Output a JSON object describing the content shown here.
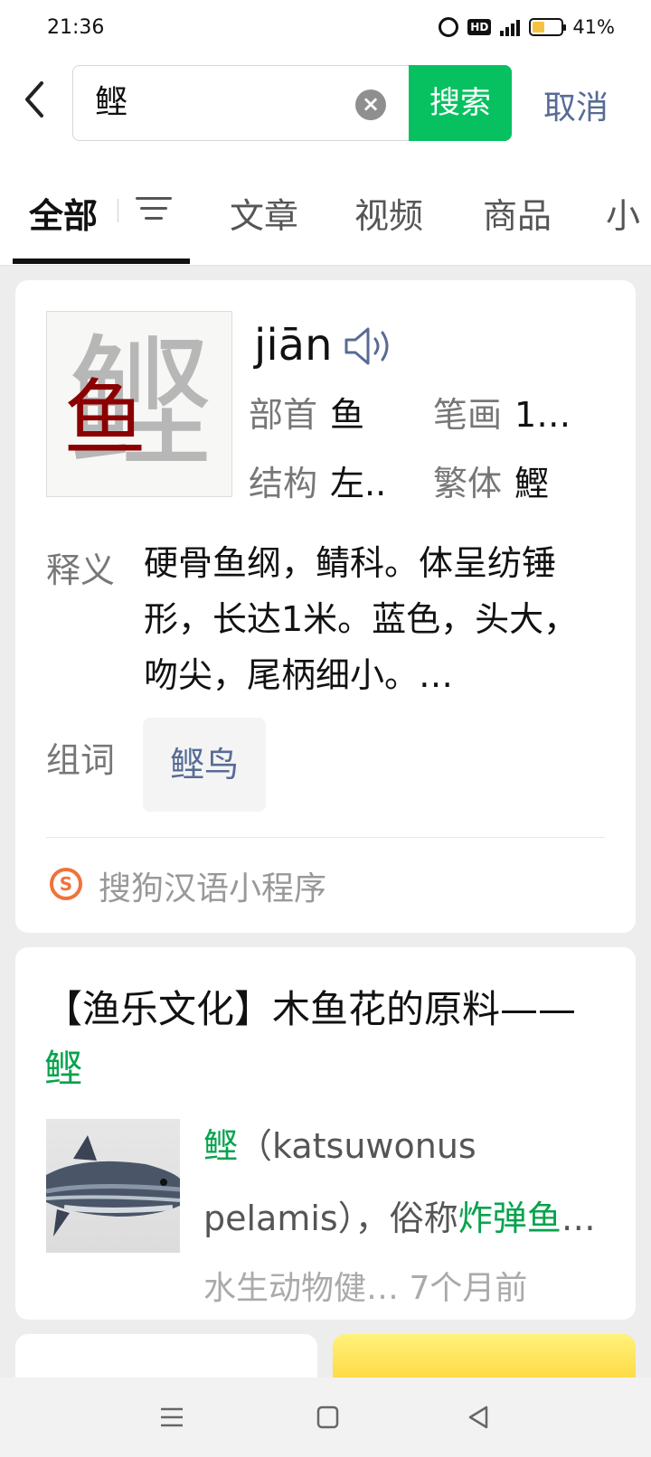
{
  "status_bar": {
    "time": "21:36",
    "network": "4G",
    "battery": "41%",
    "battery_level": 0.41,
    "hd_label": "HD"
  },
  "search": {
    "query": "鲣",
    "search_label": "搜索",
    "cancel_label": "取消"
  },
  "tabs": [
    {
      "label": "全部",
      "active": true
    },
    {
      "label": "文章",
      "active": false
    },
    {
      "label": "视频",
      "active": false
    },
    {
      "label": "商品",
      "active": false
    },
    {
      "label": "小",
      "active": false
    }
  ],
  "dictionary": {
    "character": "鲣",
    "radical_part": "鱼",
    "pinyin": "jiān",
    "radical_label": "部首",
    "radical_value": "鱼",
    "strokes_label": "笔画",
    "strokes_value": "1…",
    "structure_label": "结构",
    "structure_value": "左..",
    "traditional_label": "繁体",
    "traditional_value": "鰹",
    "definition_label": "释义",
    "definition": "硬骨鱼纲，鲭科。体呈纺锤形，长达1米。蓝色，头大，吻尖，尾柄细小。…",
    "words_label": "组词",
    "words": [
      "鲣鸟"
    ],
    "source": "搜狗汉语小程序",
    "source_icon": "sogou-icon"
  },
  "article": {
    "title_main": "【渔乐文化】木鱼花的原料——",
    "title_highlight": "鲣",
    "snippet_highlight_1": "鲣",
    "snippet_part_1": "（katsuwonus pelamis），俗称",
    "snippet_highlight_2": "炸弹鱼",
    "snippet_ellipsis": "…",
    "meta": "水生动物健…  7个月前",
    "highlight_color": "#07a34d"
  },
  "colors": {
    "accent_green": "#07c160",
    "link_blue": "#576b95"
  }
}
